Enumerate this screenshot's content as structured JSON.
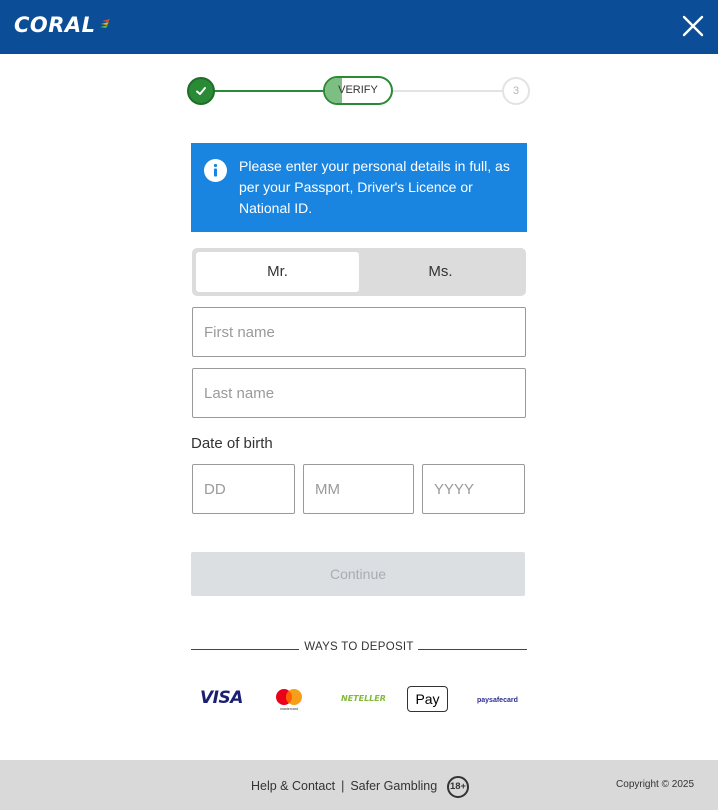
{
  "header": {
    "logo_text": "CORAL",
    "brand_color": "#0b4d96",
    "close_icon": "close-icon"
  },
  "stepper": {
    "step1_state": "complete",
    "step1_icon": "check-icon",
    "step2_label": "VERIFY",
    "step3_label": "3",
    "accent_color": "#2a8a35"
  },
  "info": {
    "icon": "info-icon",
    "text": "Please enter your personal details in full, as per your Passport, Driver's Licence or National ID.",
    "color": "#1a85e0"
  },
  "title_toggle": {
    "options": [
      "Mr.",
      "Ms."
    ],
    "selected": "Mr."
  },
  "form": {
    "first_name_placeholder": "First name",
    "last_name_placeholder": "Last name",
    "dob_label": "Date of birth",
    "dd_placeholder": "DD",
    "mm_placeholder": "MM",
    "yyyy_placeholder": "YYYY",
    "continue_label": "Continue"
  },
  "deposit": {
    "heading": "WAYS TO DEPOSIT",
    "methods": [
      "VISA",
      "mastercard",
      "NETELLER",
      "Pay",
      "paysafecard"
    ]
  },
  "footer": {
    "help_link": "Help & Contact",
    "separator": "|",
    "safer_gambling_link": "Safer Gambling",
    "age_badge": "18+",
    "copyright": "Copyright © 2025"
  }
}
